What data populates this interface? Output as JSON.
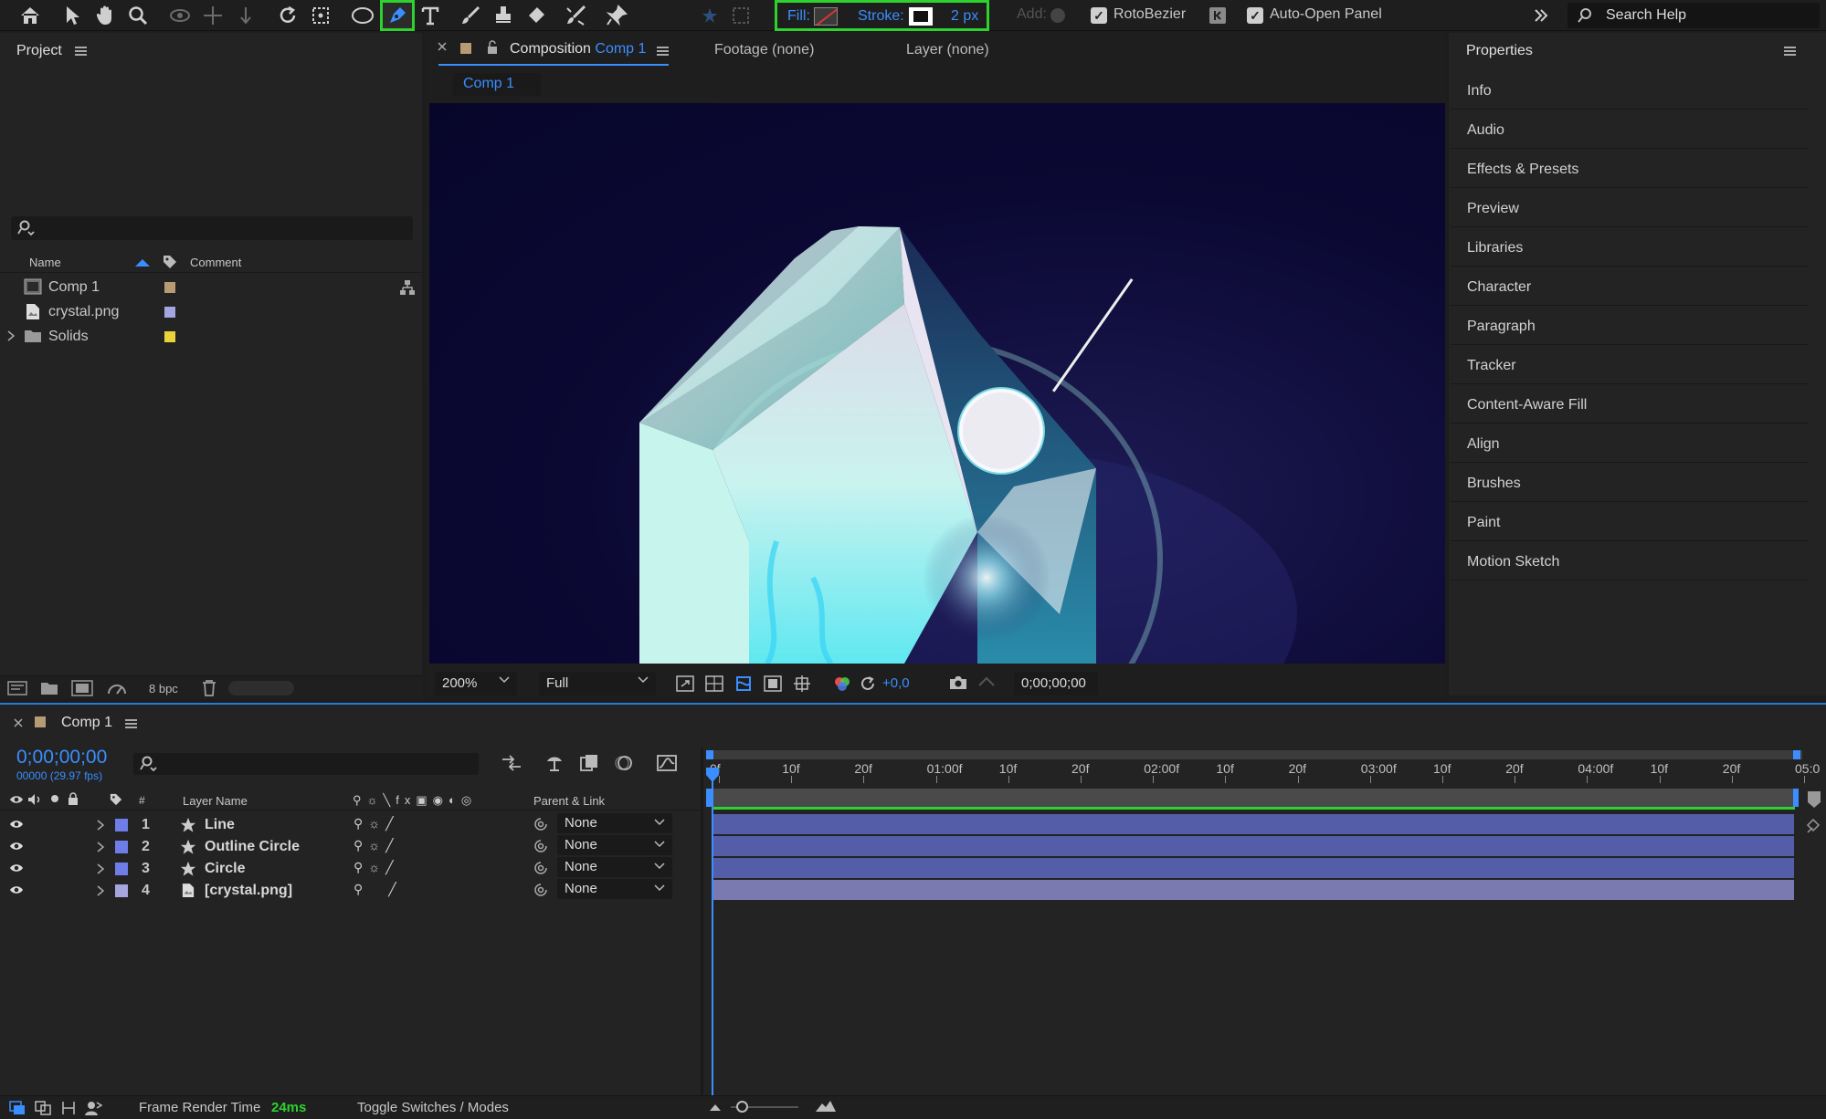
{
  "toolbar": {
    "fill_label": "Fill:",
    "stroke_label": "Stroke:",
    "stroke_width": "2 px",
    "add_label": "Add:",
    "rotobezier_label": "RotoBezier",
    "autoopen_label": "Auto-Open Panel",
    "search_placeholder": "Search Help",
    "accent_color": "#2ed12e"
  },
  "project": {
    "title": "Project",
    "col_name": "Name",
    "col_comment": "Comment",
    "items": [
      {
        "name": "Comp 1",
        "color": "#b79b74"
      },
      {
        "name": "crystal.png",
        "color": "#a5a5e0"
      },
      {
        "name": "Solids",
        "color": "#e8d43a"
      }
    ],
    "bpc": "8 bpc"
  },
  "composition": {
    "tab_prefix": "Composition",
    "tab_comp": "Comp 1",
    "footage_tab": "Footage (none)",
    "layer_tab": "Layer (none)",
    "sub_tab": "Comp 1",
    "zoom": "200%",
    "resolution": "Full",
    "exposure": "+0,0",
    "timecode": "0;00;00;00"
  },
  "properties": {
    "title": "Properties",
    "items": [
      "Info",
      "Audio",
      "Effects & Presets",
      "Preview",
      "Libraries",
      "Character",
      "Paragraph",
      "Tracker",
      "Content-Aware Fill",
      "Align",
      "Brushes",
      "Paint",
      "Motion Sketch"
    ]
  },
  "timeline": {
    "comp_name": "Comp 1",
    "timecode": "0;00;00;00",
    "fps_label": "00000 (29.97 fps)",
    "col_num": "#",
    "col_layer_name": "Layer Name",
    "col_parent": "Parent & Link",
    "layers": [
      {
        "num": "1",
        "name": "Line",
        "parent": "None",
        "color": "#6f7de8",
        "bar_color": "#545ea8"
      },
      {
        "num": "2",
        "name": "Outline Circle",
        "parent": "None",
        "color": "#6f7de8",
        "bar_color": "#545ea8"
      },
      {
        "num": "3",
        "name": "Circle",
        "parent": "None",
        "color": "#6f7de8",
        "bar_color": "#545ea8"
      },
      {
        "num": "4",
        "name": "[crystal.png]",
        "parent": "None",
        "color": "#a5a5e0",
        "bar_color": "#7a7ab0"
      }
    ],
    "ruler": [
      "0f",
      "10f",
      "20f",
      "01:00f",
      "10f",
      "20f",
      "02:00f",
      "10f",
      "20f",
      "03:00f",
      "10f",
      "20f",
      "04:00f",
      "10f",
      "20f",
      "05:0"
    ],
    "footer_render_label": "Frame Render Time",
    "footer_render_value": "24ms",
    "footer_toggle": "Toggle Switches / Modes"
  }
}
